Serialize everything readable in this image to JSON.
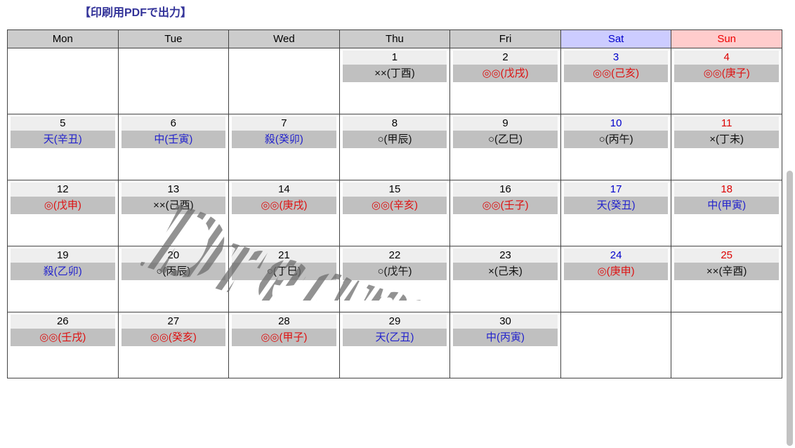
{
  "page": {
    "title_link": "【印刷用PDFで出力】",
    "title_color": "#333399",
    "background": "#ffffff"
  },
  "watermark": {
    "text": "Dreamstime",
    "color": "#808080"
  },
  "scrollbar": {
    "thumb_color": "#c2c2c2"
  },
  "calendar": {
    "colors": {
      "header_bg": "#cccccc",
      "sat_header_bg": "#ccccff",
      "sat_header_fg": "#0000cc",
      "sun_header_bg": "#ffcccc",
      "sun_header_fg": "#ee0000",
      "daynum_bg": "#eeeeee",
      "dayinfo_bg": "#c0c0c0",
      "grid_line": "#444444",
      "red_text": "#dd1111",
      "blue_text": "#2222cc",
      "black_text": "#111111"
    },
    "headers": [
      {
        "label": "Mon",
        "kind": "weekday"
      },
      {
        "label": "Tue",
        "kind": "weekday"
      },
      {
        "label": "Wed",
        "kind": "weekday"
      },
      {
        "label": "Thu",
        "kind": "weekday"
      },
      {
        "label": "Fri",
        "kind": "weekday"
      },
      {
        "label": "Sat",
        "kind": "saturday"
      },
      {
        "label": "Sun",
        "kind": "sunday"
      }
    ],
    "weeks": [
      [
        {
          "day": "",
          "info": "",
          "info_color": "",
          "num_color": ""
        },
        {
          "day": "",
          "info": "",
          "info_color": "",
          "num_color": ""
        },
        {
          "day": "",
          "info": "",
          "info_color": "",
          "num_color": ""
        },
        {
          "day": "1",
          "info": "××(丁酉)",
          "info_color": "black",
          "num_color": ""
        },
        {
          "day": "2",
          "info": "◎◎(戊戌)",
          "info_color": "red",
          "num_color": ""
        },
        {
          "day": "3",
          "info": "◎◎(己亥)",
          "info_color": "red",
          "num_color": "sat"
        },
        {
          "day": "4",
          "info": "◎◎(庚子)",
          "info_color": "red",
          "num_color": "sun"
        }
      ],
      [
        {
          "day": "5",
          "info": "天(辛丑)",
          "info_color": "blue",
          "num_color": ""
        },
        {
          "day": "6",
          "info": "中(壬寅)",
          "info_color": "blue",
          "num_color": ""
        },
        {
          "day": "7",
          "info": "殺(癸卯)",
          "info_color": "blue",
          "num_color": ""
        },
        {
          "day": "8",
          "info": "○(甲辰)",
          "info_color": "black",
          "num_color": ""
        },
        {
          "day": "9",
          "info": "○(乙巳)",
          "info_color": "black",
          "num_color": ""
        },
        {
          "day": "10",
          "info": "○(丙午)",
          "info_color": "black",
          "num_color": "sat"
        },
        {
          "day": "11",
          "info": "×(丁未)",
          "info_color": "black",
          "num_color": "sun"
        }
      ],
      [
        {
          "day": "12",
          "info": "◎(戊申)",
          "info_color": "red",
          "num_color": ""
        },
        {
          "day": "13",
          "info": "××(己酉)",
          "info_color": "black",
          "num_color": ""
        },
        {
          "day": "14",
          "info": "◎◎(庚戌)",
          "info_color": "red",
          "num_color": ""
        },
        {
          "day": "15",
          "info": "◎◎(辛亥)",
          "info_color": "red",
          "num_color": ""
        },
        {
          "day": "16",
          "info": "◎◎(壬子)",
          "info_color": "red",
          "num_color": ""
        },
        {
          "day": "17",
          "info": "天(癸丑)",
          "info_color": "blue",
          "num_color": "sat"
        },
        {
          "day": "18",
          "info": "中(甲寅)",
          "info_color": "blue",
          "num_color": "sun"
        }
      ],
      [
        {
          "day": "19",
          "info": "殺(乙卯)",
          "info_color": "blue",
          "num_color": ""
        },
        {
          "day": "20",
          "info": "○(丙辰)",
          "info_color": "black",
          "num_color": ""
        },
        {
          "day": "21",
          "info": "○(丁巳)",
          "info_color": "black",
          "num_color": ""
        },
        {
          "day": "22",
          "info": "○(戊午)",
          "info_color": "black",
          "num_color": ""
        },
        {
          "day": "23",
          "info": "×(己未)",
          "info_color": "black",
          "num_color": ""
        },
        {
          "day": "24",
          "info": "◎(庚申)",
          "info_color": "red",
          "num_color": "sat"
        },
        {
          "day": "25",
          "info": "××(辛酉)",
          "info_color": "black",
          "num_color": "sun"
        }
      ],
      [
        {
          "day": "26",
          "info": "◎◎(壬戌)",
          "info_color": "red",
          "num_color": ""
        },
        {
          "day": "27",
          "info": "◎◎(癸亥)",
          "info_color": "red",
          "num_color": ""
        },
        {
          "day": "28",
          "info": "◎◎(甲子)",
          "info_color": "red",
          "num_color": ""
        },
        {
          "day": "29",
          "info": "天(乙丑)",
          "info_color": "blue",
          "num_color": ""
        },
        {
          "day": "30",
          "info": "中(丙寅)",
          "info_color": "blue",
          "num_color": ""
        },
        {
          "day": "",
          "info": "",
          "info_color": "",
          "num_color": ""
        },
        {
          "day": "",
          "info": "",
          "info_color": "",
          "num_color": ""
        }
      ]
    ]
  }
}
